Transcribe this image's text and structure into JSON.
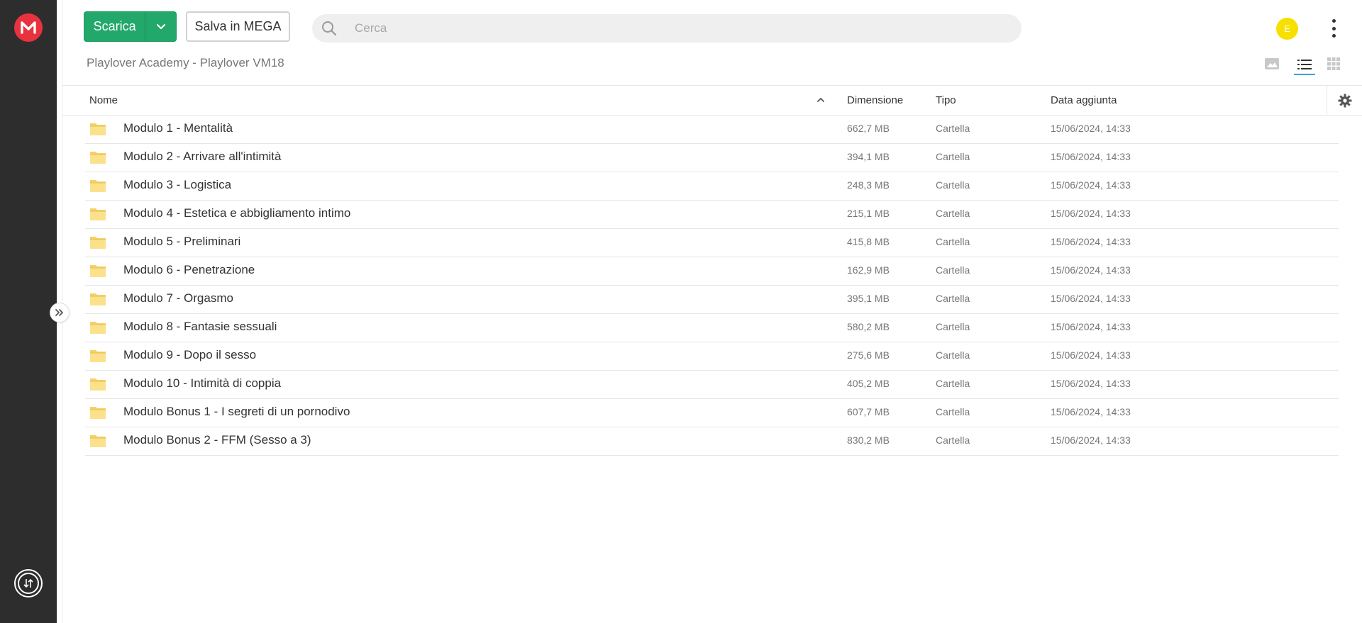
{
  "toolbar": {
    "download_label": "Scarica",
    "save_label": "Salva in MEGA"
  },
  "search": {
    "placeholder": "Cerca"
  },
  "user": {
    "avatar_initial": "E",
    "avatar_color": "#f7e000"
  },
  "brand": {
    "logo": "mega-logo-icon",
    "logo_color": "#e8333f",
    "accent_green": "#22a86b"
  },
  "breadcrumb": "Playlover Academy - Playlover VM18",
  "view_modes": [
    "photo-view-icon",
    "list-view-icon",
    "grid-view-icon"
  ],
  "active_view": "list",
  "table": {
    "columns": {
      "name": "Nome",
      "size": "Dimensione",
      "type": "Tipo",
      "date": "Data aggiunta"
    },
    "sort": "ascending",
    "rows": [
      {
        "name": "Modulo 1 - Mentalità",
        "size": "662,7 MB",
        "type": "Cartella",
        "date": "15/06/2024, 14:33"
      },
      {
        "name": "Modulo 2 - Arrivare all'intimità",
        "size": "394,1 MB",
        "type": "Cartella",
        "date": "15/06/2024, 14:33"
      },
      {
        "name": "Modulo 3 - Logistica",
        "size": "248,3 MB",
        "type": "Cartella",
        "date": "15/06/2024, 14:33"
      },
      {
        "name": "Modulo 4 - Estetica e abbigliamento intimo",
        "size": "215,1 MB",
        "type": "Cartella",
        "date": "15/06/2024, 14:33"
      },
      {
        "name": "Modulo 5 - Preliminari",
        "size": "415,8 MB",
        "type": "Cartella",
        "date": "15/06/2024, 14:33"
      },
      {
        "name": "Modulo 6 - Penetrazione",
        "size": "162,9 MB",
        "type": "Cartella",
        "date": "15/06/2024, 14:33"
      },
      {
        "name": "Modulo 7 - Orgasmo",
        "size": "395,1 MB",
        "type": "Cartella",
        "date": "15/06/2024, 14:33"
      },
      {
        "name": "Modulo 8 - Fantasie sessuali",
        "size": "580,2 MB",
        "type": "Cartella",
        "date": "15/06/2024, 14:33"
      },
      {
        "name": "Modulo 9 - Dopo il sesso",
        "size": "275,6 MB",
        "type": "Cartella",
        "date": "15/06/2024, 14:33"
      },
      {
        "name": "Modulo 10 - Intimità di coppia",
        "size": "405,2 MB",
        "type": "Cartella",
        "date": "15/06/2024, 14:33"
      },
      {
        "name": "Modulo Bonus 1 - I segreti di un pornodivo",
        "size": "607,7 MB",
        "type": "Cartella",
        "date": "15/06/2024, 14:33"
      },
      {
        "name": "Modulo Bonus 2 - FFM (Sesso a 3)",
        "size": "830,2 MB",
        "type": "Cartella",
        "date": "15/06/2024, 14:33"
      }
    ]
  }
}
